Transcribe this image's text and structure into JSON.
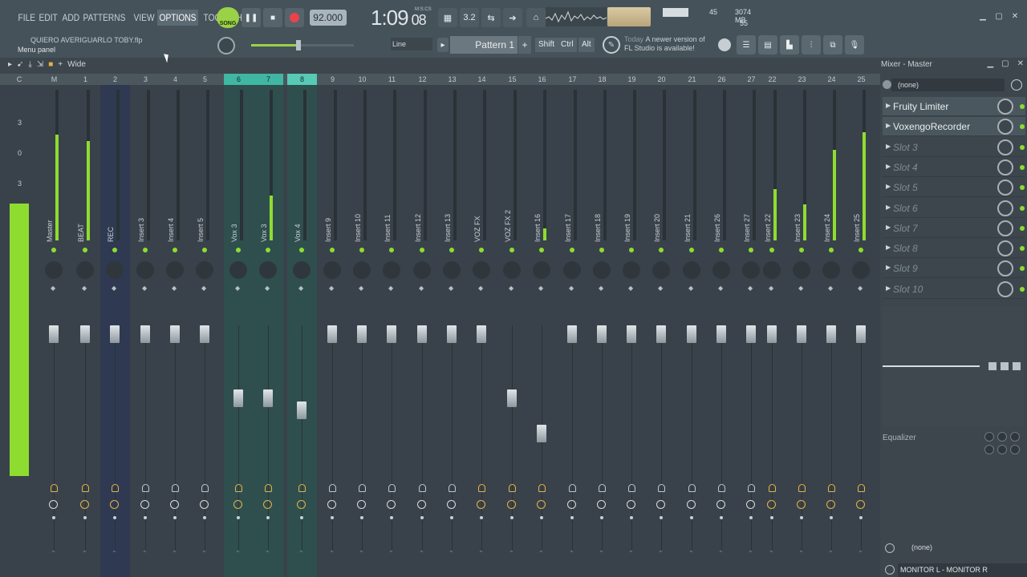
{
  "menu": [
    "FILE",
    "EDIT",
    "ADD",
    "PATTERNS",
    "VIEW",
    "OPTIONS",
    "TOOLS",
    "HELP"
  ],
  "menu_active": "OPTIONS",
  "transport": {
    "song_label": "SONG",
    "tempo": "92.000"
  },
  "time": {
    "main": "1:09",
    "frames": "08",
    "unit_label": "M:S:CS"
  },
  "memory": {
    "value": "45",
    "mb": "3074 MB",
    "voices": "55"
  },
  "project": {
    "name": "QUIERO AVERIGUARLO TOBY.flp",
    "hint": "Menu panel"
  },
  "snap": "Line",
  "pattern": "Pattern 1",
  "pattern_add": "+",
  "modkeys": [
    "Shift",
    "Ctrl",
    "Alt"
  ],
  "news": {
    "when": "Today",
    "text1": "A newer version of",
    "text2": "FL Studio is available!"
  },
  "mixer": {
    "wide_label": "Wide",
    "title": "Mixer - Master"
  },
  "numbers": [
    "C",
    "M",
    "1",
    "2",
    "3",
    "4",
    "5",
    "6",
    "7",
    "8",
    "9",
    "10",
    "11",
    "12",
    "13",
    "14",
    "15",
    "16",
    "17",
    "18",
    "19",
    "20",
    "21",
    "26",
    "27",
    "22",
    "23",
    "24",
    "25"
  ],
  "strips": [
    {
      "num": "M",
      "name": "Master",
      "level": 70,
      "fader": 0.0,
      "route": true,
      "sync": false,
      "tint": ""
    },
    {
      "num": "1",
      "name": "BEAT",
      "level": 66,
      "fader": 0.0,
      "route": true,
      "sync": true,
      "tint": ""
    },
    {
      "num": "2",
      "name": "REC",
      "level": 0,
      "fader": 0.0,
      "route": true,
      "sync": true,
      "tint": "blue"
    },
    {
      "num": "3",
      "name": "Insert 3",
      "level": 0,
      "fader": 0.0,
      "route": false,
      "sync": false,
      "tint": ""
    },
    {
      "num": "4",
      "name": "Insert 4",
      "level": 0,
      "fader": 0.0,
      "route": false,
      "sync": false,
      "tint": ""
    },
    {
      "num": "5",
      "name": "Insert 5",
      "level": 0,
      "fader": 0.0,
      "route": false,
      "sync": false,
      "tint": ""
    },
    {
      "num": "6",
      "name": "Vox 3",
      "level": 0,
      "fader": 0.42,
      "route": true,
      "sync": true,
      "tint": "teal"
    },
    {
      "num": "7",
      "name": "Vox 3",
      "level": 30,
      "fader": 0.42,
      "route": true,
      "sync": true,
      "tint": "teal"
    },
    {
      "num": "8",
      "name": "Vox 4",
      "level": 0,
      "fader": 0.5,
      "route": true,
      "sync": true,
      "tint": "teal"
    },
    {
      "num": "9",
      "name": "Insert 9",
      "level": 0,
      "fader": 0.0,
      "route": false,
      "sync": false,
      "tint": ""
    },
    {
      "num": "10",
      "name": "Insert 10",
      "level": 0,
      "fader": 0.0,
      "route": false,
      "sync": false,
      "tint": ""
    },
    {
      "num": "11",
      "name": "Insert 11",
      "level": 0,
      "fader": 0.0,
      "route": false,
      "sync": false,
      "tint": ""
    },
    {
      "num": "12",
      "name": "Insert 12",
      "level": 0,
      "fader": 0.0,
      "route": false,
      "sync": false,
      "tint": ""
    },
    {
      "num": "13",
      "name": "Insert 13",
      "level": 0,
      "fader": 0.0,
      "route": false,
      "sync": false,
      "tint": ""
    },
    {
      "num": "14",
      "name": "VOZ FX",
      "level": 0,
      "fader": 0.0,
      "route": true,
      "sync": true,
      "tint": ""
    },
    {
      "num": "15",
      "name": "VOZ FX 2",
      "level": 0,
      "fader": 0.42,
      "route": true,
      "sync": true,
      "tint": ""
    },
    {
      "num": "16",
      "name": "Insert 16",
      "level": 8,
      "fader": 0.65,
      "route": true,
      "sync": true,
      "tint": ""
    },
    {
      "num": "17",
      "name": "Insert 17",
      "level": 0,
      "fader": 0.0,
      "route": false,
      "sync": false,
      "tint": ""
    },
    {
      "num": "18",
      "name": "Insert 18",
      "level": 0,
      "fader": 0.0,
      "route": false,
      "sync": false,
      "tint": ""
    },
    {
      "num": "19",
      "name": "Insert 19",
      "level": 0,
      "fader": 0.0,
      "route": false,
      "sync": false,
      "tint": ""
    },
    {
      "num": "20",
      "name": "Insert 20",
      "level": 0,
      "fader": 0.0,
      "route": false,
      "sync": false,
      "tint": ""
    },
    {
      "num": "21",
      "name": "Insert 21",
      "level": 0,
      "fader": 0.0,
      "route": false,
      "sync": false,
      "tint": ""
    },
    {
      "num": "26",
      "name": "Insert 26",
      "level": 0,
      "fader": 0.0,
      "route": false,
      "sync": false,
      "tint": ""
    },
    {
      "num": "27",
      "name": "Insert 27",
      "level": 0,
      "fader": 0.0,
      "route": false,
      "sync": false,
      "tint": ""
    },
    {
      "num": "22",
      "name": "Insert 22",
      "level": 34,
      "fader": 0.0,
      "route": true,
      "sync": true,
      "tint": ""
    },
    {
      "num": "23",
      "name": "Insert 23",
      "level": 24,
      "fader": 0.0,
      "route": true,
      "sync": true,
      "tint": ""
    },
    {
      "num": "24",
      "name": "Insert 24",
      "level": 60,
      "fader": 0.0,
      "route": true,
      "sync": true,
      "tint": ""
    },
    {
      "num": "25",
      "name": "Insert 25",
      "level": 72,
      "fader": 0.0,
      "route": true,
      "sync": true,
      "tint": ""
    }
  ],
  "right_panel": {
    "preset": "(none)",
    "slots": [
      "Fruity Limiter",
      "VoxengoRecorder",
      "Slot 3",
      "Slot 4",
      "Slot 5",
      "Slot 6",
      "Slot 7",
      "Slot 8",
      "Slot 9",
      "Slot 10"
    ],
    "filled_slots": 2,
    "eq_label": "Equalizer",
    "output": "(none)",
    "monitor": "MONITOR L - MONITOR R"
  },
  "scale": [
    "3",
    "0",
    "3"
  ],
  "colors": {
    "meter": "#8fdc30",
    "selected": "#40b7a2",
    "accent_route": "#e5b348"
  }
}
